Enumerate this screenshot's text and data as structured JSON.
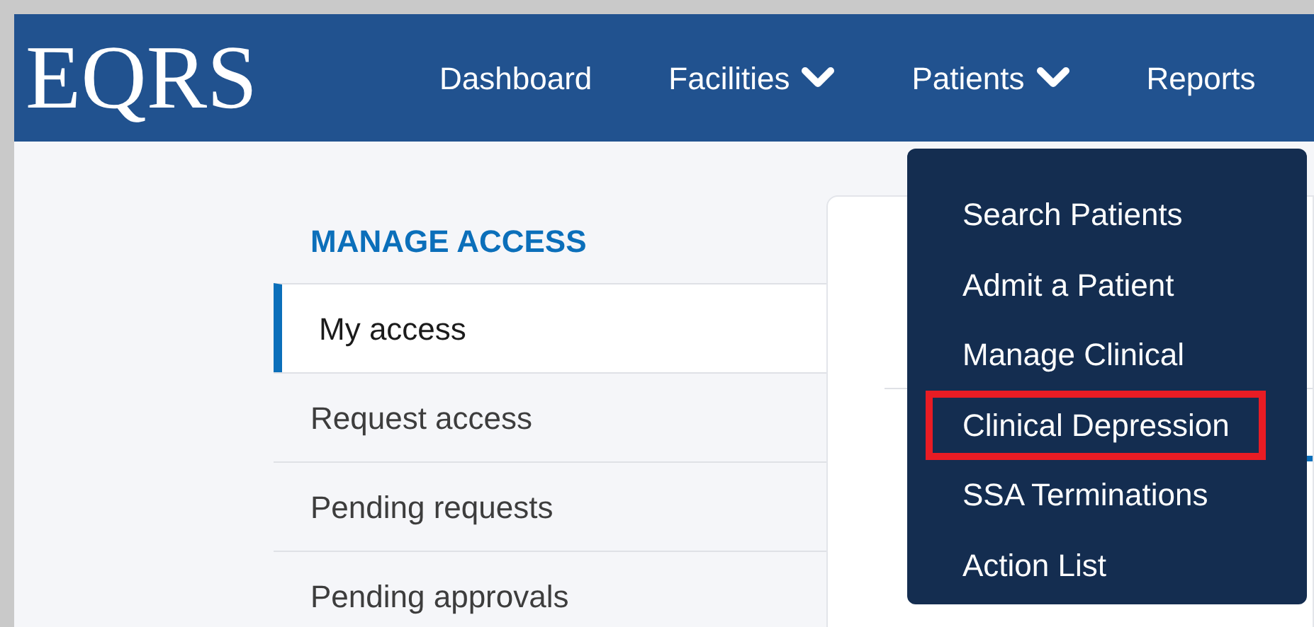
{
  "header": {
    "logo": "EQRS",
    "nav": [
      {
        "label": "Dashboard",
        "dropdown": false
      },
      {
        "label": "Facilities",
        "dropdown": true
      },
      {
        "label": "Patients",
        "dropdown": true
      },
      {
        "label": "Reports",
        "dropdown": false
      }
    ]
  },
  "sidebar": {
    "heading": "MANAGE ACCESS",
    "items": [
      {
        "label": "My access",
        "selected": true
      },
      {
        "label": "Request access",
        "selected": false
      },
      {
        "label": "Pending requests",
        "selected": false
      },
      {
        "label": "Pending approvals",
        "selected": false
      }
    ]
  },
  "patients_menu": {
    "items": [
      {
        "label": "Search Patients",
        "highlighted": false
      },
      {
        "label": "Admit a Patient",
        "highlighted": false
      },
      {
        "label": "Manage Clinical",
        "highlighted": false
      },
      {
        "label": "Clinical Depression",
        "highlighted": true
      },
      {
        "label": "SSA Terminations",
        "highlighted": false
      },
      {
        "label": "Action List",
        "highlighted": false
      }
    ]
  }
}
